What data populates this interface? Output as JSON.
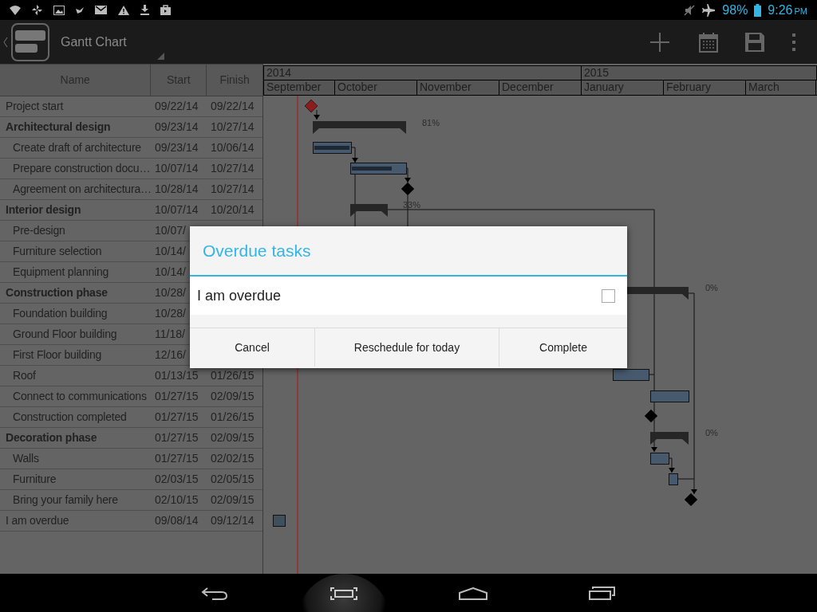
{
  "status_bar": {
    "battery": "98%",
    "time": "9:26",
    "meridiem": "PM"
  },
  "action_bar": {
    "title": "Gantt Chart"
  },
  "table": {
    "columns": [
      "Name",
      "Start",
      "Finish"
    ],
    "rows": [
      {
        "name": "Project start",
        "start": "09/22/14",
        "finish": "09/22/14"
      },
      {
        "name": "Architectural design",
        "start": "09/23/14",
        "finish": "10/27/14",
        "children": [
          {
            "name": "Create draft of architecture",
            "start": "09/23/14",
            "finish": "10/06/14"
          },
          {
            "name": "Prepare construction docu…",
            "start": "10/07/14",
            "finish": "10/27/14"
          },
          {
            "name": "Agreement on architectura…",
            "start": "10/28/14",
            "finish": "10/27/14"
          }
        ]
      },
      {
        "name": "Interior design",
        "start": "10/07/14",
        "finish": "10/20/14",
        "children": [
          {
            "name": "Pre-design",
            "start": "10/07/"
          },
          {
            "name": "Furniture selection",
            "start": "10/14/"
          },
          {
            "name": "Equipment planning",
            "start": "10/14/"
          }
        ]
      },
      {
        "name": "Construction phase",
        "start": "10/28/",
        "children": [
          {
            "name": "Foundation building",
            "start": "10/28/"
          },
          {
            "name": "Ground Floor building",
            "start": "11/18/"
          },
          {
            "name": "First Floor building",
            "start": "12/16/"
          },
          {
            "name": "Roof",
            "start": "01/13/15",
            "finish": "01/26/15"
          },
          {
            "name": "Connect to communications",
            "start": "01/27/15",
            "finish": "02/09/15"
          },
          {
            "name": "Construction completed",
            "start": "01/27/15",
            "finish": "01/26/15"
          }
        ]
      },
      {
        "name": "Decoration phase",
        "start": "01/27/15",
        "finish": "02/09/15",
        "children": [
          {
            "name": "Walls",
            "start": "01/27/15",
            "finish": "02/02/15"
          },
          {
            "name": "Furniture",
            "start": "02/03/15",
            "finish": "02/05/15"
          },
          {
            "name": "Bring your family here",
            "start": "02/10/15",
            "finish": "02/09/15"
          }
        ]
      },
      {
        "name": "I am overdue",
        "start": "09/08/14",
        "finish": "09/12/14"
      }
    ]
  },
  "timeline": {
    "years": [
      "2014",
      "2015"
    ],
    "months": [
      "September",
      "October",
      "November",
      "December",
      "January",
      "February",
      "March"
    ],
    "progress_labels": [
      "81%",
      "33%",
      "0%",
      "0%"
    ]
  },
  "dialog": {
    "title": "Overdue tasks",
    "items": [
      {
        "label": "I am overdue",
        "checked": false
      }
    ],
    "buttons": [
      "Cancel",
      "Reschedule for today",
      "Complete"
    ]
  }
}
